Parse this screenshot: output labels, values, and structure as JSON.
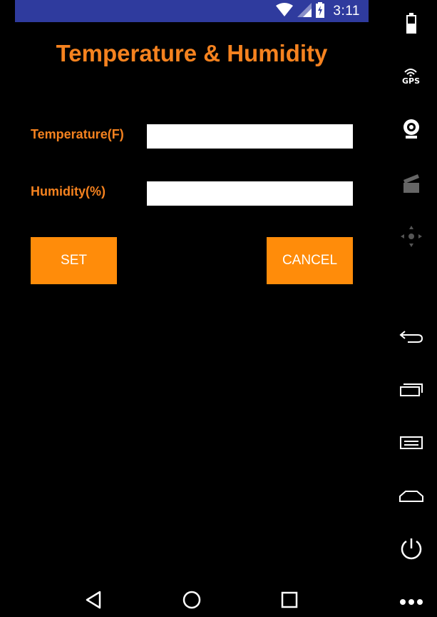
{
  "status_bar": {
    "time": "3:11",
    "icons": [
      "wifi-icon",
      "cell-signal-icon",
      "battery-charging-icon"
    ],
    "color": "#2f3b9e"
  },
  "app": {
    "title": "Temperature & Humidity",
    "accent_color": "#f5821f",
    "fields": {
      "temperature": {
        "label": "Temperature(F)",
        "value": ""
      },
      "humidity": {
        "label": "Humidity(%)",
        "value": ""
      }
    },
    "buttons": {
      "set": "SET",
      "cancel": "CANCEL",
      "color": "#ff8c0a"
    }
  },
  "nav_bar": {
    "icons": [
      "back-icon",
      "home-icon",
      "recents-icon"
    ]
  },
  "emulator_panel": {
    "icons": [
      "battery-icon",
      "gps-icon",
      "camera-icon",
      "media-icon",
      "dpad-icon",
      "back-icon",
      "recents-icon",
      "menu-icon",
      "home-icon",
      "power-icon",
      "more-icon"
    ],
    "gps_label": "GPS"
  }
}
